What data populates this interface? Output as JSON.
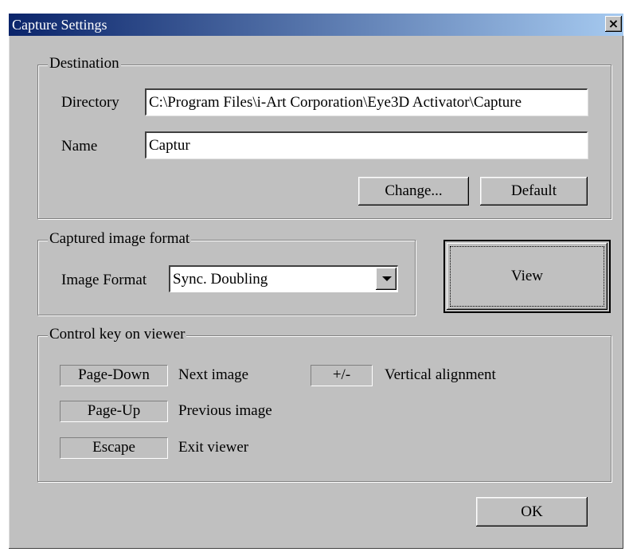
{
  "window": {
    "title": "Capture Settings",
    "close_glyph": "×",
    "close_icon": "close-icon"
  },
  "destination": {
    "legend": "Destination",
    "directory_label": "Directory",
    "directory_value": "C:\\Program Files\\i-Art Corporation\\Eye3D Activator\\Capture",
    "name_label": "Name",
    "name_value": "Captur",
    "change_label": "Change...",
    "default_label": "Default"
  },
  "format": {
    "legend": "Captured image format",
    "image_format_label": "Image Format",
    "image_format_value": "Sync. Doubling",
    "dropdown_icon": "chevron-down-icon"
  },
  "view_label": "View",
  "controls": {
    "legend": "Control key on viewer",
    "keys": [
      {
        "key": "Page-Down",
        "action": "Next image"
      },
      {
        "key": "Page-Up",
        "action": "Previous image"
      },
      {
        "key": "Escape",
        "action": "Exit viewer"
      },
      {
        "key": "+/-",
        "action": "Vertical alignment"
      }
    ]
  },
  "ok_label": "OK"
}
